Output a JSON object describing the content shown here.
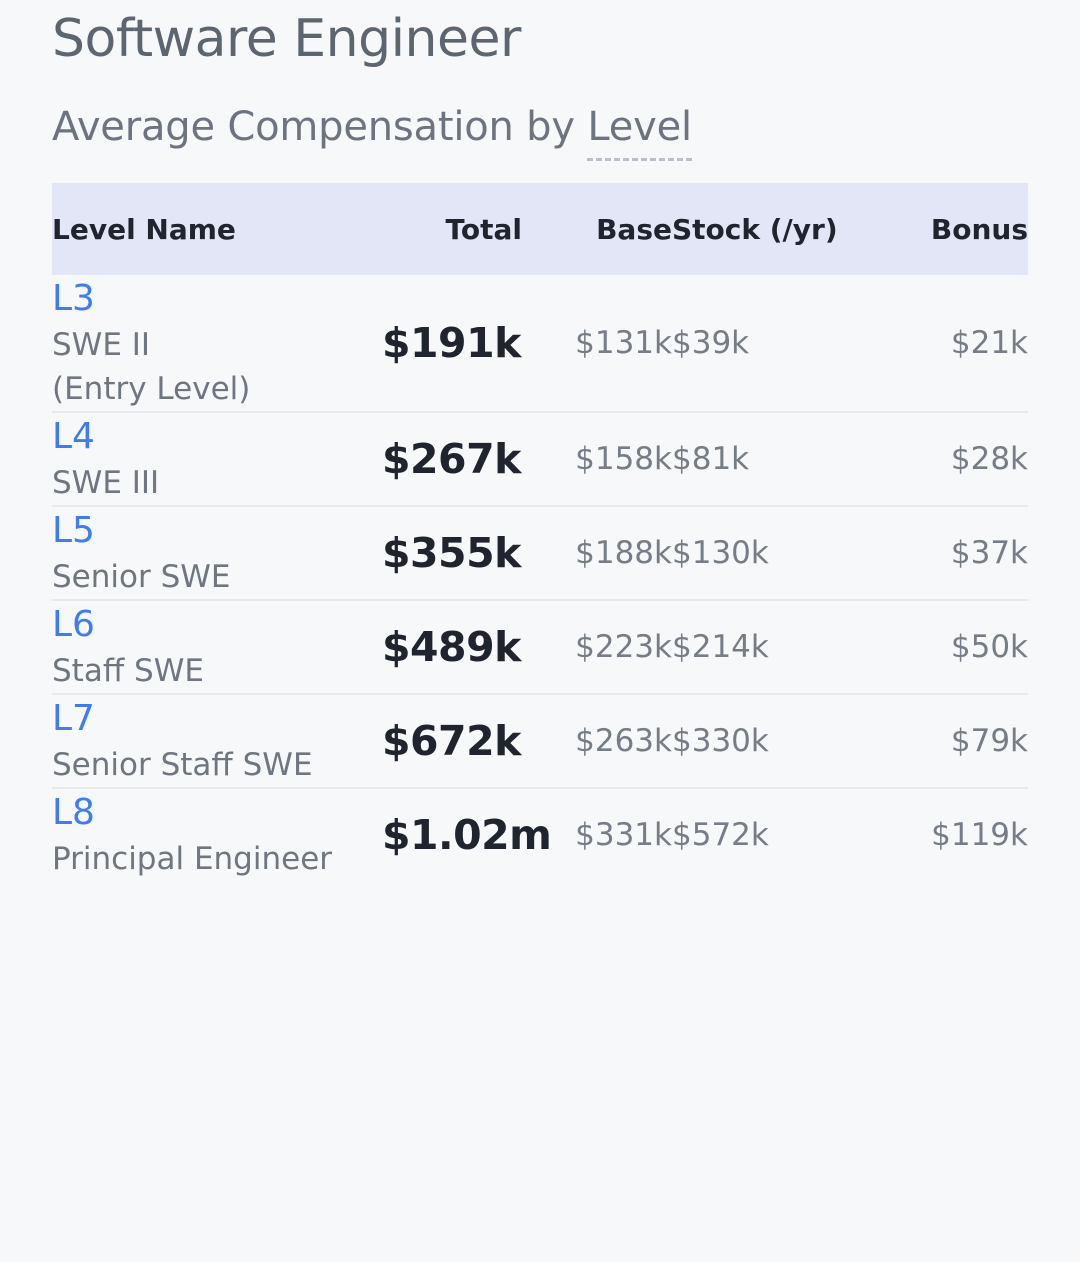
{
  "header": {
    "title": "Software Engineer",
    "subtitle_prefix": "Average Compensation by ",
    "subtitle_term": "Level"
  },
  "table": {
    "columns": {
      "level": "Level Name",
      "total": "Total",
      "base": "Base",
      "stock": "Stock (/yr)",
      "bonus": "Bonus"
    },
    "rows": [
      {
        "code": "L3",
        "name": "SWE II\n(Entry Level)",
        "total": "$191k",
        "base": "$131k",
        "stock": "$39k",
        "bonus": "$21k"
      },
      {
        "code": "L4",
        "name": "SWE III",
        "total": "$267k",
        "base": "$158k",
        "stock": "$81k",
        "bonus": "$28k"
      },
      {
        "code": "L5",
        "name": "Senior SWE",
        "total": "$355k",
        "base": "$188k",
        "stock": "$130k",
        "bonus": "$37k"
      },
      {
        "code": "L6",
        "name": "Staff SWE",
        "total": "$489k",
        "base": "$223k",
        "stock": "$214k",
        "bonus": "$50k"
      },
      {
        "code": "L7",
        "name": "Senior Staff SWE",
        "total": "$672k",
        "base": "$263k",
        "stock": "$330k",
        "bonus": "$79k"
      },
      {
        "code": "L8",
        "name": "Principal Engineer",
        "total": "$1.02m",
        "base": "$331k",
        "stock": "$572k",
        "bonus": "$119k"
      }
    ]
  },
  "colors": {
    "page_background": "#f7f8fa",
    "header_row_background": "#e2e6f6",
    "level_link": "#3f7cf0",
    "title_text": "#5d656f",
    "muted_text": "#767d87",
    "strong_text": "#20242e",
    "row_divider": "#e8eaee"
  },
  "chart_data": {
    "type": "table",
    "title": "Software Engineer — Average Compensation by Level",
    "columns": [
      "Level Name",
      "Total",
      "Base",
      "Stock (/yr)",
      "Bonus"
    ],
    "categories": [
      "L3",
      "L4",
      "L5",
      "L6",
      "L7",
      "L8"
    ],
    "level_titles": [
      "SWE II (Entry Level)",
      "SWE III",
      "Senior SWE",
      "Staff SWE",
      "Senior Staff SWE",
      "Principal Engineer"
    ],
    "series": [
      {
        "name": "Total",
        "values": [
          191000,
          267000,
          355000,
          489000,
          672000,
          1020000
        ],
        "labels": [
          "$191k",
          "$267k",
          "$355k",
          "$489k",
          "$672k",
          "$1.02m"
        ]
      },
      {
        "name": "Base",
        "values": [
          131000,
          158000,
          188000,
          223000,
          263000,
          331000
        ],
        "labels": [
          "$131k",
          "$158k",
          "$188k",
          "$223k",
          "$263k",
          "$331k"
        ]
      },
      {
        "name": "Stock (/yr)",
        "values": [
          39000,
          81000,
          130000,
          214000,
          330000,
          572000
        ],
        "labels": [
          "$39k",
          "$81k",
          "$130k",
          "$214k",
          "$330k",
          "$572k"
        ]
      },
      {
        "name": "Bonus",
        "values": [
          21000,
          28000,
          37000,
          50000,
          79000,
          119000
        ],
        "labels": [
          "$21k",
          "$28k",
          "$37k",
          "$50k",
          "$79k",
          "$119k"
        ]
      }
    ],
    "units": "USD per year"
  }
}
